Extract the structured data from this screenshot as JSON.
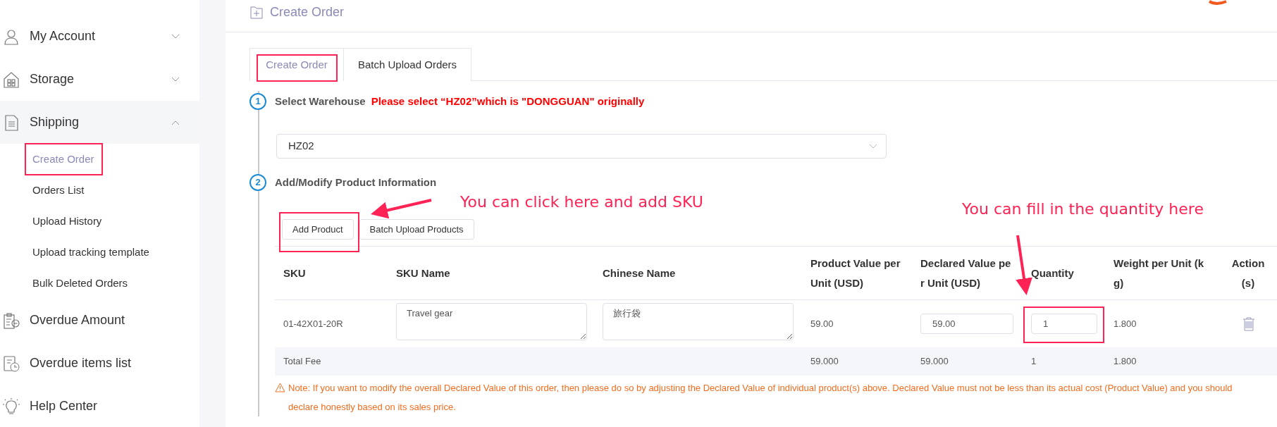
{
  "page_header": {
    "title": "Create Order"
  },
  "sidebar": {
    "items": [
      {
        "label": "My Account",
        "expanded": false
      },
      {
        "label": "Storage",
        "expanded": false
      },
      {
        "label": "Shipping",
        "expanded": true,
        "children": [
          {
            "label": "Create Order",
            "selected": true
          },
          {
            "label": "Orders List",
            "selected": false
          },
          {
            "label": "Upload History",
            "selected": false
          },
          {
            "label": "Upload tracking template",
            "selected": false
          },
          {
            "label": "Bulk Deleted Orders",
            "selected": false
          }
        ]
      },
      {
        "label": "Overdue Amount"
      },
      {
        "label": "Overdue items list"
      },
      {
        "label": "Help Center"
      }
    ]
  },
  "tabs": [
    {
      "label": "Create Order",
      "selected": true
    },
    {
      "label": "Batch Upload Orders",
      "selected": false
    }
  ],
  "steps": [
    {
      "number": "1",
      "title": "Select Warehouse",
      "note": "Please select “HZ02”which is \"DONGGUAN\" originally",
      "warehouse": "HZ02"
    },
    {
      "number": "2",
      "title": "Add/Modify Product Information",
      "buttons": [
        "Add Product",
        "Batch Upload Products"
      ]
    }
  ],
  "table": {
    "columns": [
      "SKU",
      "SKU Name",
      "Chinese Name",
      "Product Value per Unit (USD)",
      "Declared Value per Unit (USD)",
      "Quantity",
      "Weight per Unit (kg)",
      "Action(s)"
    ],
    "rows": [
      {
        "sku": "01-42X01-20R",
        "sku_name": "Travel gear",
        "chinese_name": "旅行袋",
        "product_value": "59.00",
        "declared_value": "59.00",
        "quantity": "1",
        "weight": "1.800"
      }
    ],
    "total": {
      "label": "Total Fee",
      "product_value": "59.000",
      "declared_value": "59.000",
      "quantity": "1",
      "weight": "1.800"
    }
  },
  "note": "Note: If you want to modify the overall Declared Value of this order, then please do so by adjusting the Declared Value of individual product(s) above. Declared Value must not be less than its actual cost (Product Value) and you should declare honestly based on its sales price.",
  "annotations": [
    "You can click here and add SKU",
    "You can fill in the quantity here"
  ]
}
